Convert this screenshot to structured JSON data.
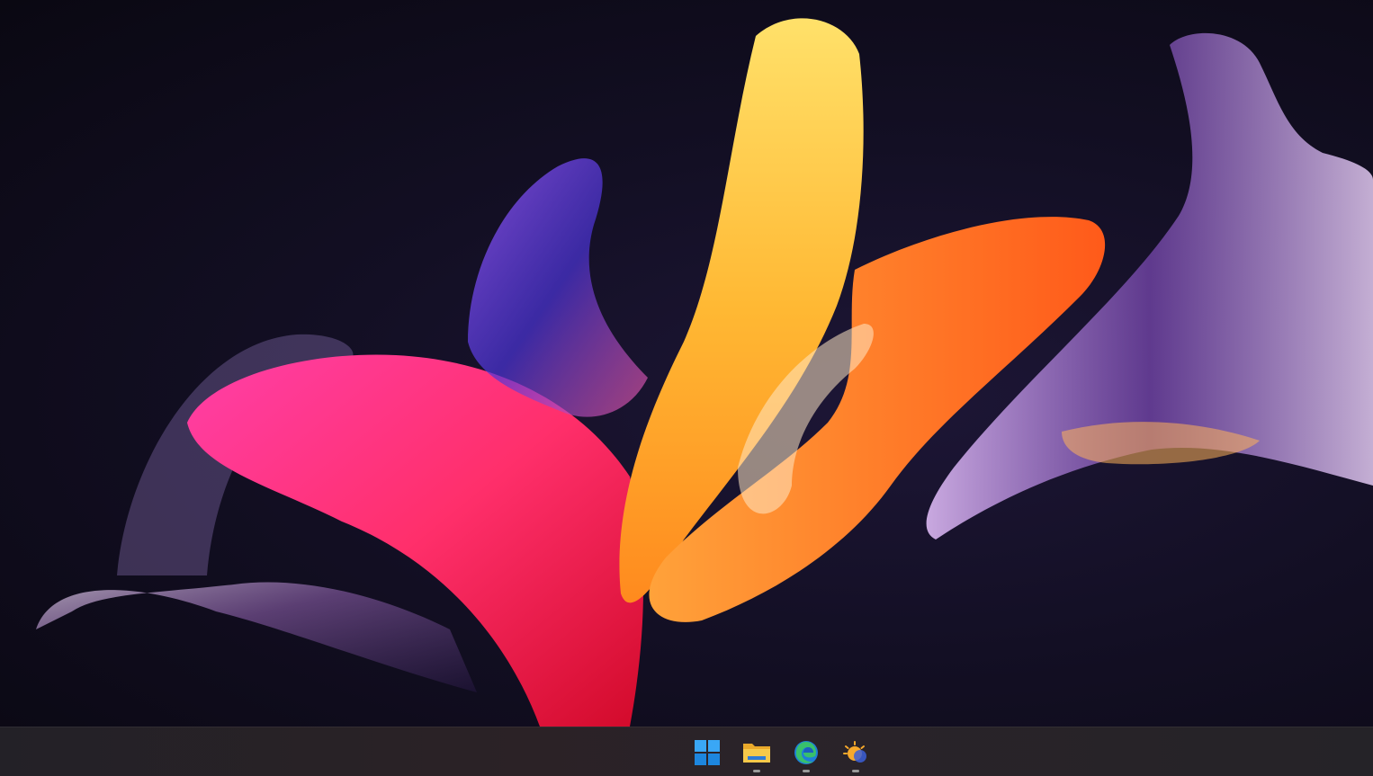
{
  "desktop": {
    "wallpaper_name": "abstract-bloom-wallpaper"
  },
  "taskbar": {
    "buttons": [
      {
        "icon": "windows-start-icon",
        "running": false
      },
      {
        "icon": "file-explorer-icon",
        "running": true
      },
      {
        "icon": "edge-browser-icon",
        "running": true
      },
      {
        "icon": "weather-icon",
        "running": true
      }
    ],
    "colors": {
      "start_blue": "#2d9cf0",
      "folder_yellow": "#f4c443",
      "edge_blue": "#1e7fd8",
      "edge_green": "#38c06c",
      "weather_orange": "#f7a92b"
    }
  }
}
